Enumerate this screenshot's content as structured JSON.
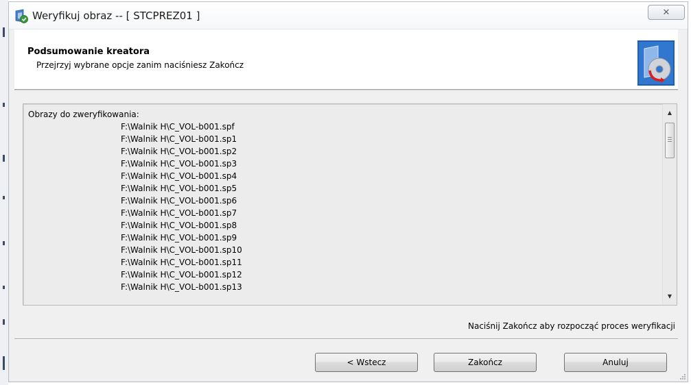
{
  "window": {
    "title": "Weryfikuj obraz -- [ STCPREZ01 ]",
    "close_glyph": "✕"
  },
  "header": {
    "title": "Podsumowanie kreatora",
    "subtitle": "Przejrzyj wybrane opcje zanim naciśniesz Zakończ",
    "icon": "verify-image-disc-icon"
  },
  "summary": {
    "heading": "Obrazy do zweryfikowania:",
    "files": [
      "F:\\Walnik H\\C_VOL-b001.spf",
      "F:\\Walnik H\\C_VOL-b001.sp1",
      "F:\\Walnik H\\C_VOL-b001.sp2",
      "F:\\Walnik H\\C_VOL-b001.sp3",
      "F:\\Walnik H\\C_VOL-b001.sp4",
      "F:\\Walnik H\\C_VOL-b001.sp5",
      "F:\\Walnik H\\C_VOL-b001.sp6",
      "F:\\Walnik H\\C_VOL-b001.sp7",
      "F:\\Walnik H\\C_VOL-b001.sp8",
      "F:\\Walnik H\\C_VOL-b001.sp9",
      "F:\\Walnik H\\C_VOL-b001.sp10",
      "F:\\Walnik H\\C_VOL-b001.sp11",
      "F:\\Walnik H\\C_VOL-b001.sp12",
      "F:\\Walnik H\\C_VOL-b001.sp13"
    ]
  },
  "status": "Naciśnij Zakończ aby rozpocząć proces weryfikacji",
  "buttons": {
    "back": "< Wstecz",
    "finish": "Zakończ",
    "cancel": "Anuluj"
  },
  "colors": {
    "accent_blue": "#1e5fb4",
    "frame": "#f0f0f0"
  }
}
